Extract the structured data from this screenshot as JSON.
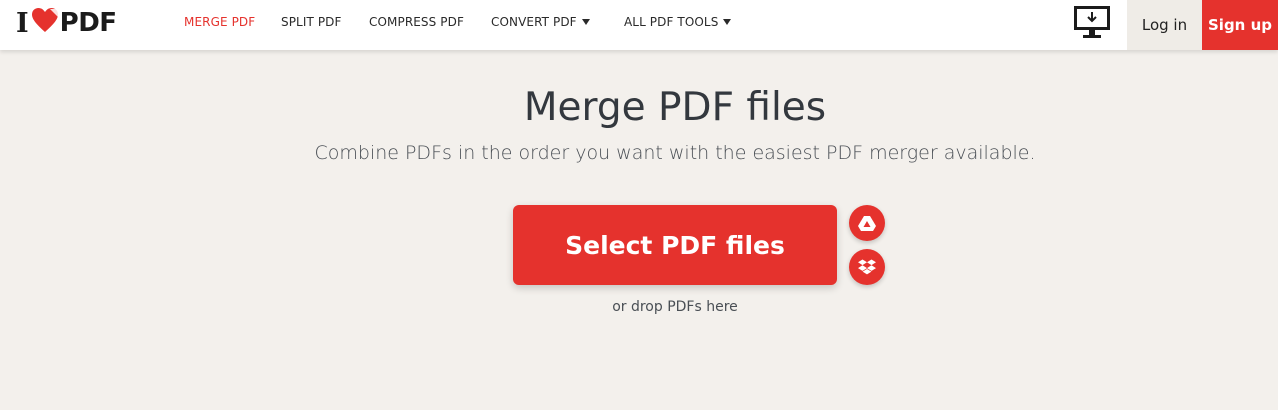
{
  "brand": {
    "prefix": "I",
    "suffix": "PDF",
    "accent_color": "#e5322d"
  },
  "nav": {
    "items": [
      {
        "label": "MERGE PDF",
        "active": true
      },
      {
        "label": "SPLIT PDF"
      },
      {
        "label": "COMPRESS PDF"
      },
      {
        "label": "CONVERT PDF",
        "dropdown": true
      },
      {
        "label": "ALL PDF TOOLS",
        "dropdown": true
      }
    ]
  },
  "header_actions": {
    "desktop_icon": "desktop-download-icon",
    "login_label": "Log in",
    "signup_label": "Sign up"
  },
  "main": {
    "title": "Merge PDF files",
    "subtitle": "Combine PDFs in the order you want with the easiest PDF merger available.",
    "select_button_label": "Select PDF files",
    "cloud_buttons": [
      "google-drive-icon",
      "dropbox-icon"
    ],
    "drop_hint": "or drop PDFs here"
  }
}
